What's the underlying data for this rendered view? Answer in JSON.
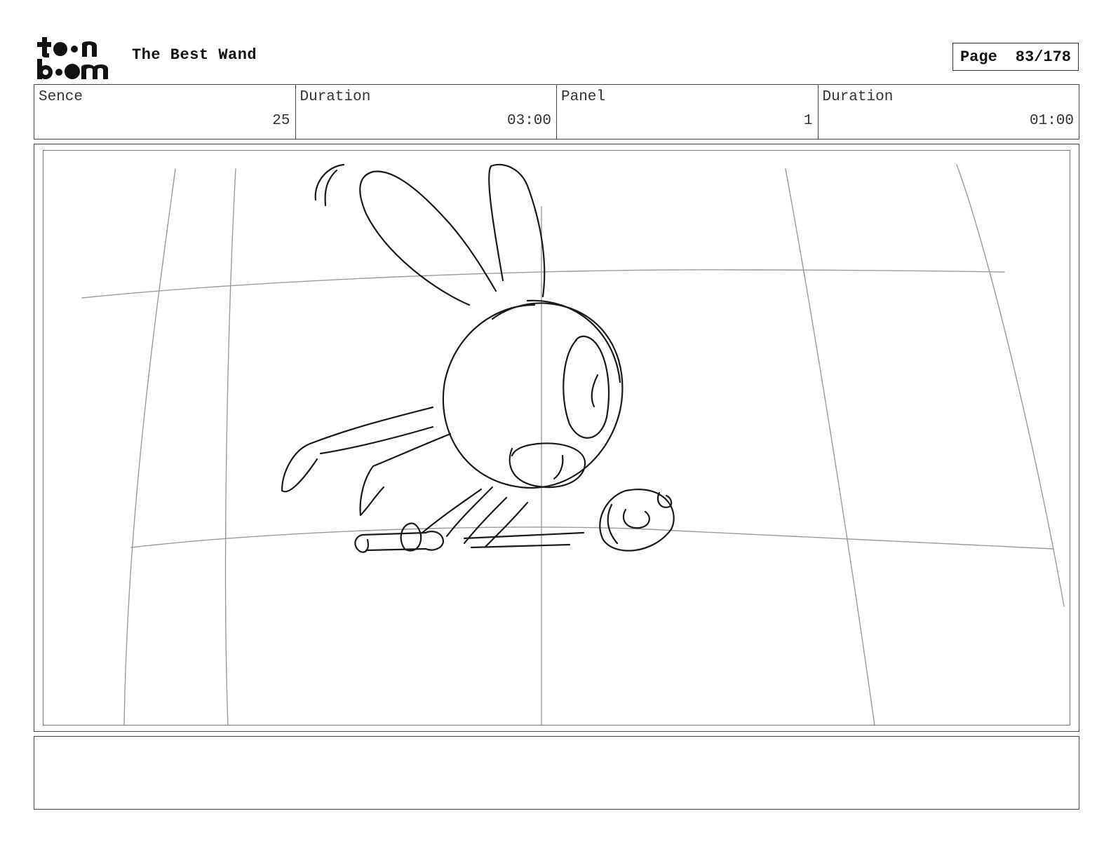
{
  "header": {
    "logo_text": "toon boom",
    "project_title": "The Best Wand",
    "page_label": "Page",
    "page_number": "83/178"
  },
  "info": {
    "scene_label": "Sence",
    "scene_value": "25",
    "scene_duration_label": "Duration",
    "scene_duration_value": "03:00",
    "panel_label": "Panel",
    "panel_value": "1",
    "panel_duration_label": "Duration",
    "panel_duration_value": "01:00"
  },
  "notes": {
    "text": ""
  }
}
